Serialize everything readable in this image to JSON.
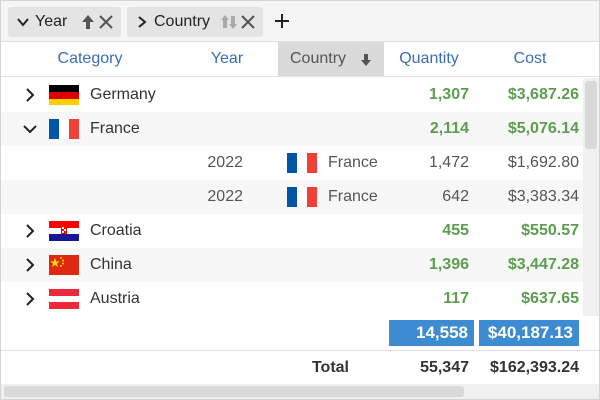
{
  "group_panel": {
    "chips": [
      {
        "label": "Year",
        "expanded": true,
        "sort": "ascending"
      },
      {
        "label": "Country",
        "expanded": false,
        "sort": "none"
      }
    ],
    "add_icon": "plus-icon"
  },
  "columns": [
    {
      "label": "Category"
    },
    {
      "label": "Year"
    },
    {
      "label": "Country",
      "sorted": "descending"
    },
    {
      "label": "Quantity"
    },
    {
      "label": "Cost"
    }
  ],
  "rows": [
    {
      "type": "group",
      "expanded": false,
      "flag": "germany",
      "category": "Germany",
      "quantity": "1,307",
      "cost": "$3,687.26"
    },
    {
      "type": "group",
      "expanded": true,
      "flag": "france",
      "category": "France",
      "quantity": "2,114",
      "cost": "$5,076.14"
    },
    {
      "type": "detail",
      "year": "2022",
      "flag": "france",
      "country": "France",
      "quantity": "1,472",
      "cost": "$1,692.80"
    },
    {
      "type": "detail",
      "year": "2022",
      "flag": "france",
      "country": "France",
      "quantity": "642",
      "cost": "$3,383.34"
    },
    {
      "type": "group",
      "expanded": false,
      "flag": "croatia",
      "category": "Croatia",
      "quantity": "455",
      "cost": "$550.57"
    },
    {
      "type": "group",
      "expanded": false,
      "flag": "china",
      "category": "China",
      "quantity": "1,396",
      "cost": "$3,447.28"
    },
    {
      "type": "group",
      "expanded": false,
      "flag": "austria",
      "category": "Austria",
      "quantity": "117",
      "cost": "$637.65"
    }
  ],
  "group_total": {
    "quantity": "14,558",
    "cost": "$40,187.13"
  },
  "footer": {
    "label": "Total",
    "quantity": "55,347",
    "cost": "$162,393.24"
  },
  "colors": {
    "accent": "#3d8bd1",
    "header_text": "#3c6eb4",
    "value_green": "#5c9d50"
  }
}
